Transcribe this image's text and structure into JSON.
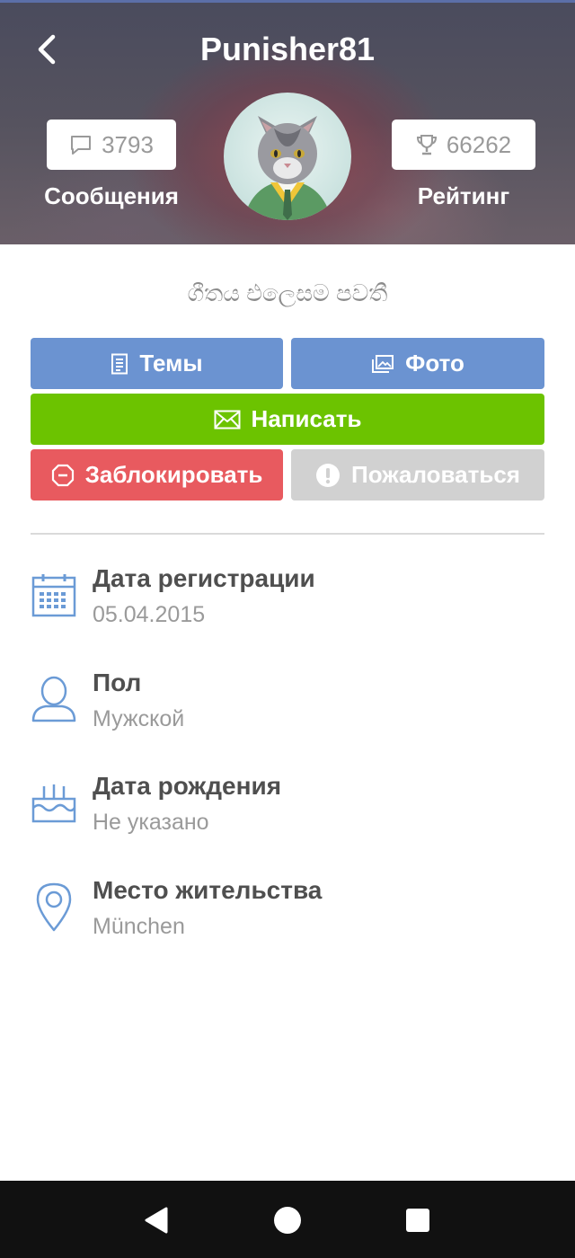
{
  "header": {
    "title": "Punisher81",
    "messages_count": "3793",
    "messages_label": "Сообщения",
    "rating_value": "66262",
    "rating_label": "Рейтинг"
  },
  "profile": {
    "status_text": "ගීතය එලෙසම පවතී"
  },
  "actions": {
    "topics_label": "Темы",
    "photo_label": "Фото",
    "write_label": "Написать",
    "block_label": "Заблокировать",
    "report_label": "Пожаловаться"
  },
  "info": [
    {
      "title": "Дата регистрации",
      "value": "05.04.2015",
      "icon": "calendar-icon"
    },
    {
      "title": "Пол",
      "value": "Мужской",
      "icon": "person-icon"
    },
    {
      "title": "Дата рождения",
      "value": "Не указано",
      "icon": "birthday-cake-icon"
    },
    {
      "title": "Место жительства",
      "value": "München",
      "icon": "location-pin-icon"
    }
  ],
  "colors": {
    "blue_button": "#6b93d1",
    "green_button": "#6cc300",
    "red_button": "#e85a5f",
    "gray_button": "#d1d1d1",
    "icon_blue": "#6b9bd6"
  },
  "navbar": {
    "icons": [
      "back-triangle-icon",
      "home-circle-icon",
      "recents-square-icon"
    ]
  }
}
